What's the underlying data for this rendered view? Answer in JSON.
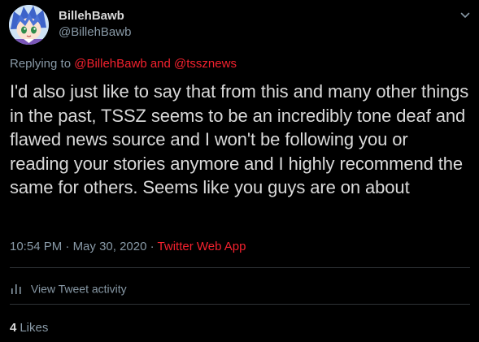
{
  "author": {
    "display_name": "BillehBawb",
    "handle": "@BillehBawb",
    "avatar_icon": "anime-avatar-icon"
  },
  "reply": {
    "prefix": "Replying to",
    "mention_1": "@BillehBawb",
    "conjunction": "and",
    "mention_2": "@tssznews"
  },
  "body": "I'd also just like to say that from this and many other things in the past, TSSZ seems to be an incredibly tone deaf and flawed news source and I won't be following you or reading your stories anymore and I highly recommend the same for others. Seems like you guys are on about",
  "meta": {
    "time": "10:54 PM",
    "sep_1": "·",
    "date": "May 30, 2020",
    "sep_2": "·",
    "source": "Twitter Web App"
  },
  "activity": {
    "icon": "bar-chart-icon",
    "label": "View Tweet activity"
  },
  "likes": {
    "count": "4",
    "label": "Likes"
  },
  "more_menu_icon": "chevron-down-icon",
  "colors": {
    "background": "#000000",
    "text_primary": "#d9d9d9",
    "text_secondary": "#8899a6",
    "accent": "#f4212e",
    "divider": "#2f3336"
  }
}
